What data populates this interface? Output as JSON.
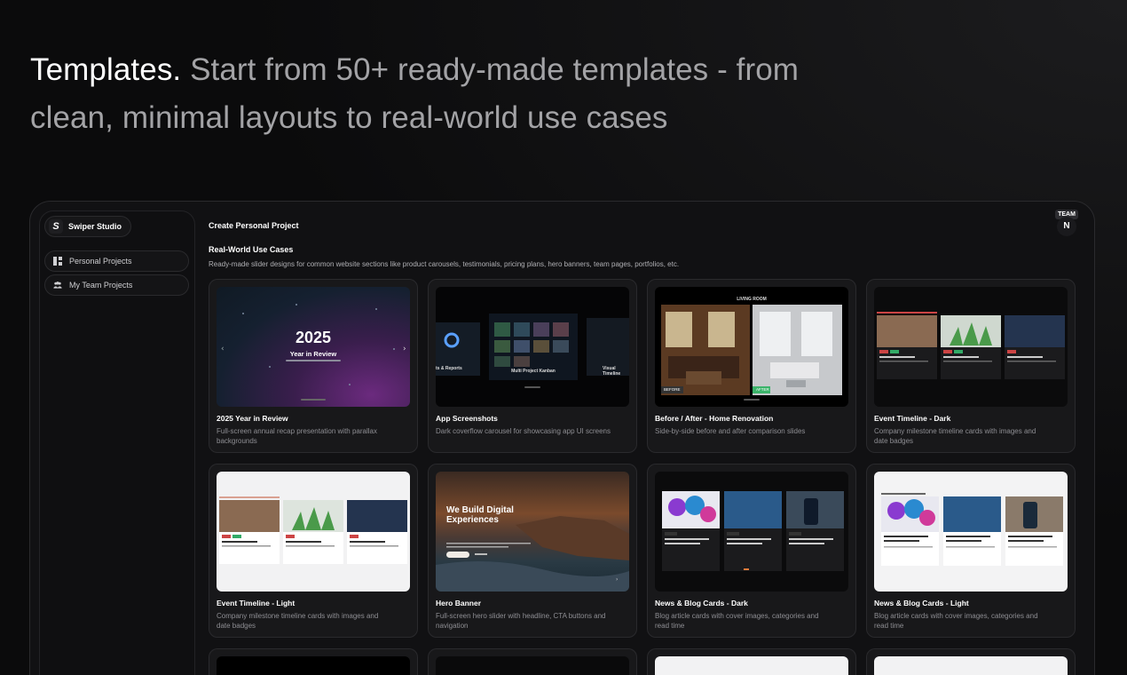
{
  "headline": {
    "lead": "Templates.",
    "rest": " Start from 50+ ready-made templates - from clean, minimal layouts to real-world use cases"
  },
  "sidebar": {
    "brand": "Swiper Studio",
    "items": [
      {
        "label": "Personal Projects",
        "icon": "grid-icon"
      },
      {
        "label": "My Team Projects",
        "icon": "users-icon"
      }
    ]
  },
  "header": {
    "title": "Create Personal Project",
    "team_badge": "TEAM",
    "avatar": "N"
  },
  "section": {
    "title": "Real-World Use Cases",
    "description": "Ready-made slider designs for common website sections like product carousels, testimonials, pricing plans, hero banners, team pages, portfolios, etc."
  },
  "cards": [
    {
      "title": "2025 Year in Review",
      "description": "Full-screen annual recap presentation with parallax backgrounds"
    },
    {
      "title": "App Screenshots",
      "description": "Dark coverflow carousel for showcasing app UI screens"
    },
    {
      "title": "Before / After - Home Renovation",
      "description": "Side-by-side before and after comparison slides"
    },
    {
      "title": "Event Timeline - Dark",
      "description": "Company milestone timeline cards with images and date badges"
    },
    {
      "title": "Event Timeline - Light",
      "description": "Company milestone timeline cards with images and date badges"
    },
    {
      "title": "Hero Banner",
      "description": "Full-screen hero slider with headline, CTA buttons and navigation"
    },
    {
      "title": "News & Blog Cards - Dark",
      "description": "Blog article cards with cover images, categories and read time"
    },
    {
      "title": "News & Blog Cards - Light",
      "description": "Blog article cards with cover images, categories and read time"
    }
  ],
  "thumbs": {
    "year_review": {
      "big": "2025",
      "sub": "Year in Review"
    },
    "app_screens": {
      "caption": "Multi Project Kanban",
      "left": "ts & Reports",
      "right": "Visual Timeline"
    },
    "before_after": {
      "room": "LIVING ROOM",
      "before": "BEFORE",
      "after": "AFTER"
    },
    "hero": {
      "headline": "We Build Digital Experiences"
    }
  },
  "colors": {
    "accent_dark": "#1a1a1d",
    "card_bg": "#18181a",
    "border": "#2a2a2d"
  }
}
